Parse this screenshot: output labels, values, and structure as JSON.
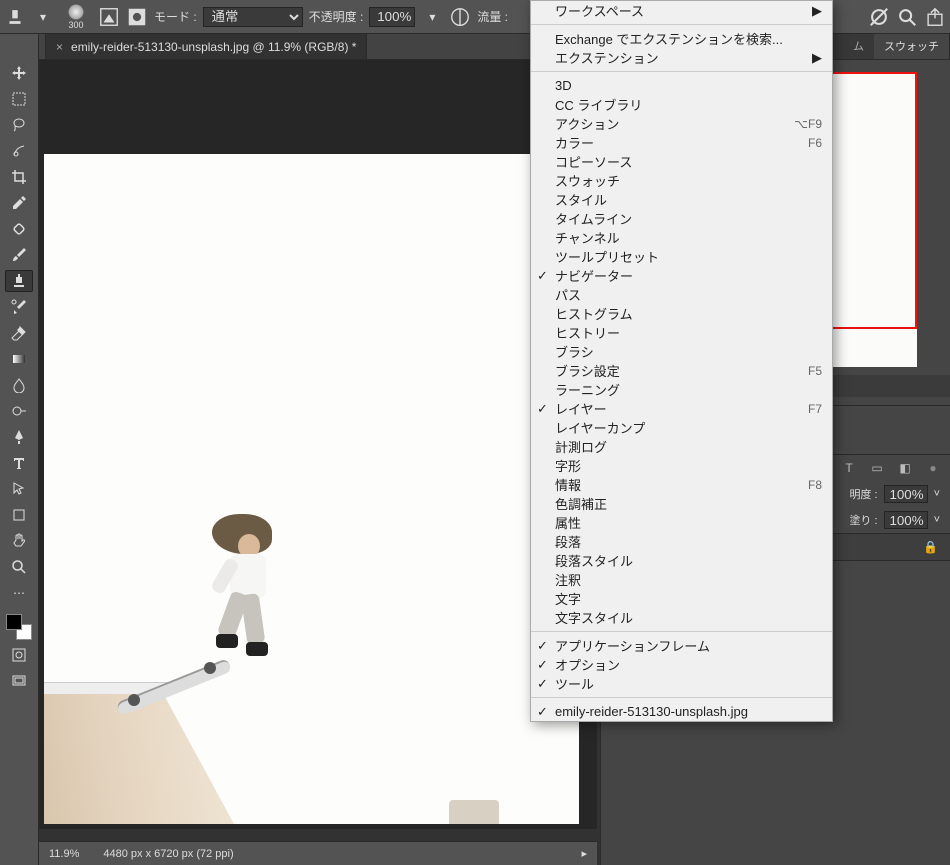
{
  "topbar": {
    "brush_size": "300",
    "mode_label": "モード :",
    "mode_value": "通常",
    "opacity_label": "不透明度 :",
    "opacity_value": "100%",
    "flow_label": "流量 :"
  },
  "tab": {
    "title": "emily-reider-513130-unsplash.jpg @ 11.9% (RGB/8) *"
  },
  "status": {
    "zoom": "11.9%",
    "dims": "4480 px x 6720 px (72 ppi)"
  },
  "panel_tabs": {
    "histogram": "ム",
    "swatches": "スウォッチ"
  },
  "layer_opts": {
    "opacity_label": "明度 :",
    "opacity_value": "100%",
    "fill_label": "塗り :",
    "fill_value": "100%"
  },
  "menu": {
    "items1": [
      {
        "label": "ワークスペース",
        "arrow": true
      }
    ],
    "items2": [
      {
        "label": "Exchange でエクステンションを検索..."
      },
      {
        "label": "エクステンション",
        "arrow": true
      }
    ],
    "items3": [
      {
        "label": "3D"
      },
      {
        "label": "CC ライブラリ"
      },
      {
        "label": "アクション",
        "shortcut": "⌥F9"
      },
      {
        "label": "カラー",
        "shortcut": "F6"
      },
      {
        "label": "コピーソース"
      },
      {
        "label": "スウォッチ"
      },
      {
        "label": "スタイル"
      },
      {
        "label": "タイムライン"
      },
      {
        "label": "チャンネル"
      },
      {
        "label": "ツールプリセット"
      },
      {
        "label": "ナビゲーター",
        "checked": true
      },
      {
        "label": "パス"
      },
      {
        "label": "ヒストグラム"
      },
      {
        "label": "ヒストリー"
      },
      {
        "label": "ブラシ"
      },
      {
        "label": "ブラシ設定",
        "shortcut": "F5"
      },
      {
        "label": "ラーニング"
      },
      {
        "label": "レイヤー",
        "checked": true,
        "shortcut": "F7"
      },
      {
        "label": "レイヤーカンプ"
      },
      {
        "label": "計測ログ"
      },
      {
        "label": "字形"
      },
      {
        "label": "情報",
        "shortcut": "F8"
      },
      {
        "label": "色調補正"
      },
      {
        "label": "属性"
      },
      {
        "label": "段落"
      },
      {
        "label": "段落スタイル"
      },
      {
        "label": "注釈"
      },
      {
        "label": "文字"
      },
      {
        "label": "文字スタイル"
      }
    ],
    "items4": [
      {
        "label": "アプリケーションフレーム",
        "checked": true
      },
      {
        "label": "オプション",
        "checked": true
      },
      {
        "label": "ツール",
        "checked": true
      }
    ],
    "items5": [
      {
        "label": "emily-reider-513130-unsplash.jpg",
        "checked": true
      }
    ]
  }
}
